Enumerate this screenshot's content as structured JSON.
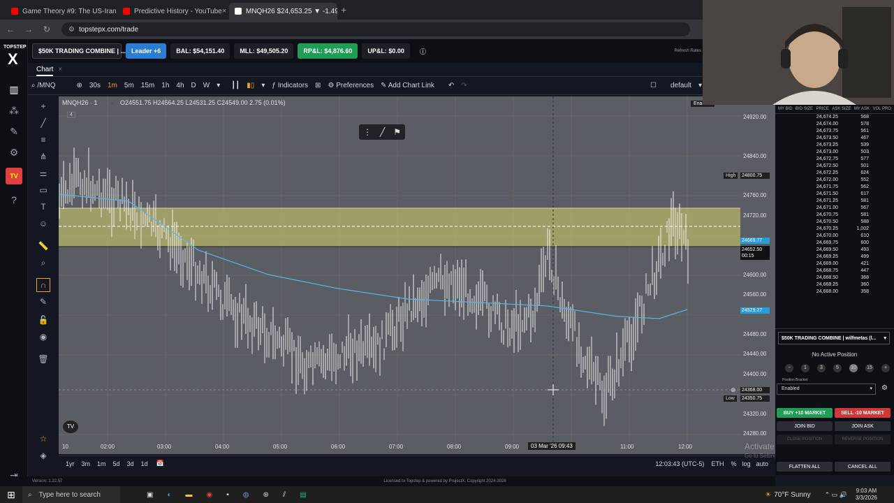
{
  "browser": {
    "tabs": [
      {
        "title": "Game Theory #9: The US-Iran W",
        "color": "#ff0000"
      },
      {
        "title": "Predictive History - YouTube",
        "color": "#ff0000"
      },
      {
        "title": "MNQH26 $24,653.25 ▼ -1.49%",
        "color": "#ffffff"
      }
    ],
    "url": "topstepx.com/trade"
  },
  "app": {
    "logo_top": "TOPSTEP",
    "logo_x": "X",
    "account": "$50K TRADING COMBINE | ...",
    "leader": "Leader +6",
    "bal": "BAL: $54,151.40",
    "mll": "MLL: $49,505.20",
    "rpl": "RP&L: $4,876.60",
    "upl": "UP&L: $0.00",
    "refresh": "Refresh Rates"
  },
  "chart_tab": "Chart",
  "toolbar": {
    "symbol": "/MNQ",
    "intervals": [
      "30s",
      "1m",
      "5m",
      "15m",
      "1h",
      "4h",
      "D",
      "W"
    ],
    "active_interval": "1m",
    "indicators": "Indicators",
    "preferences": "Preferences",
    "add_chart_link": "Add Chart Link",
    "layout": "default"
  },
  "legend": {
    "symbol": "MNQH26 · 1",
    "ohlc": "O24551.75 H24564.25 L24531.25 C24549.00  2.75 (0.01%)",
    "count": "4"
  },
  "price_axis": {
    "ticks": [
      "24920.00",
      "24840.00",
      "24760.00",
      "24720.00",
      "24640.00",
      "24600.00",
      "24560.00",
      "24480.00",
      "24440.00",
      "24400.00",
      "24320.00",
      "24280.00"
    ],
    "high_label": "High",
    "high_value": "24800.75",
    "blue_value": "24669.77",
    "last_price": "24652.50",
    "countdown": "00:15",
    "ma_value": "24529.27",
    "cursor_price": "24368.00",
    "low_label": "Low",
    "low_value": "24350.75"
  },
  "time_axis": {
    "ticks": [
      "02:00",
      "03:00",
      "04:00",
      "05:00",
      "06:00",
      "07:00",
      "08:00",
      "09:00",
      "11:00",
      "12:00"
    ],
    "cursor_time": "03 Mar '26  09:43"
  },
  "bottom": {
    "ranges": [
      "1yr",
      "3m",
      "1m",
      "5d",
      "3d",
      "1d"
    ],
    "clock": "12:03:43 (UTC-5)",
    "session": "ETH",
    "pct": "%",
    "log": "log",
    "auto": "auto",
    "watermark": "Activate Windows",
    "watermark_sub": "Go to Settings to activate Windows."
  },
  "dom": {
    "headers": [
      "MY BID",
      "BID SIZE",
      "PRICE",
      "ASK SIZE",
      "MY ASK",
      "VOL PRO"
    ],
    "rows": [
      [
        "24,674.25",
        "568"
      ],
      [
        "24,674.00",
        "578"
      ],
      [
        "24,673.75",
        "561"
      ],
      [
        "24,673.50",
        "467"
      ],
      [
        "24,673.25",
        "539"
      ],
      [
        "24,673.00",
        "503"
      ],
      [
        "24,672.75",
        "577"
      ],
      [
        "24,672.50",
        "501"
      ],
      [
        "24,672.25",
        "624"
      ],
      [
        "24,672.00",
        "552"
      ],
      [
        "24,671.75",
        "562"
      ],
      [
        "24,671.50",
        "617"
      ],
      [
        "24,671.25",
        "581"
      ],
      [
        "24,671.00",
        "567"
      ],
      [
        "24,670.75",
        "581"
      ],
      [
        "24,670.50",
        "588"
      ],
      [
        "24,670.25",
        "1,002"
      ],
      [
        "24,670.00",
        "610"
      ],
      [
        "24,669.75",
        "600"
      ],
      [
        "24,669.50",
        "493"
      ],
      [
        "24,669.25",
        "499"
      ],
      [
        "24,669.00",
        "421"
      ],
      [
        "24,668.75",
        "447"
      ],
      [
        "24,668.50",
        "368"
      ],
      [
        "24,668.25",
        "360"
      ],
      [
        "24,668.00",
        "358"
      ]
    ]
  },
  "order": {
    "account": "$50K TRADING COMBINE | wilfmetas (l...",
    "position": "No Active Position",
    "qty": [
      "1",
      "3",
      "5",
      "10",
      "15"
    ],
    "bracket_label": "Position Bracket",
    "bracket_value": "Enabled",
    "buy": "BUY +10 MARKET",
    "sell": "SELL -10 MARKET",
    "join_bid": "JOIN BID",
    "join_ask": "JOIN ASK",
    "close_position": "CLOSE POSITION",
    "reverse_position": "REVERSE POSITION",
    "flatten": "FLATTEN ALL",
    "cancel": "CANCEL ALL",
    "enabled_badge": "Enabled"
  },
  "footer": {
    "version": "Version: 1.22.57",
    "license": "Licensed to Topstep & powered by ProjectX. Copyright 2024-2026"
  },
  "taskbar": {
    "search": "Type here to search",
    "weather": "70°F  Sunny",
    "time": "9:03 AM",
    "date": "3/3/2026"
  }
}
